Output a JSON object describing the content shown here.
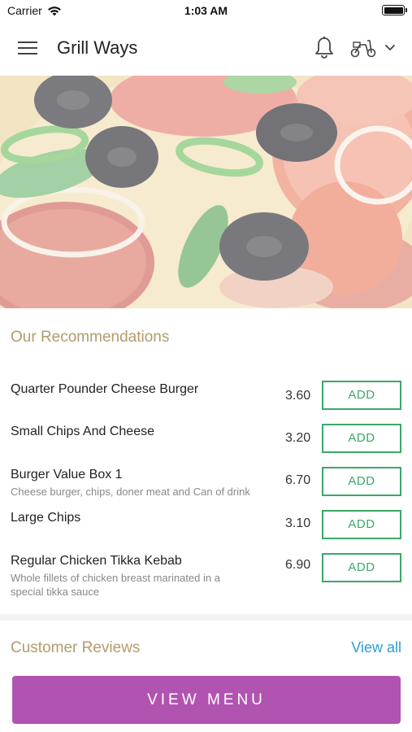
{
  "status_bar": {
    "carrier": "Carrier",
    "time": "1:03 AM"
  },
  "header": {
    "title": "Grill Ways",
    "icons": [
      "menu-icon",
      "bell-icon",
      "scooter-icon",
      "chevron-down-icon"
    ]
  },
  "hero": {
    "image": "pizza-topping-photo"
  },
  "recommendations": {
    "title": "Our Recommendations",
    "items": [
      {
        "name": "Quarter Pounder Cheese Burger",
        "description": "",
        "price": "3.60",
        "add_label": "ADD"
      },
      {
        "name": "Small Chips And Cheese",
        "description": "",
        "price": "3.20",
        "add_label": "ADD"
      },
      {
        "name": "Burger Value Box 1",
        "description": "Cheese burger, chips, doner meat and Can of drink",
        "price": "6.70",
        "add_label": "ADD"
      },
      {
        "name": "Large Chips",
        "description": "",
        "price": "3.10",
        "add_label": "ADD"
      },
      {
        "name": "Regular Chicken Tikka Kebab",
        "description": "Whole fillets of chicken breast marinated in a special tikka sauce",
        "price": "6.90",
        "add_label": "ADD"
      }
    ]
  },
  "reviews": {
    "title": "Customer Reviews",
    "view_all_label": "View all"
  },
  "footer": {
    "view_menu_label": "VIEW MENU"
  },
  "colors": {
    "accent_purple": "#b154b1",
    "add_green": "#3aa867",
    "section_gold": "#b39b6c",
    "link_blue": "#2da0cf"
  }
}
